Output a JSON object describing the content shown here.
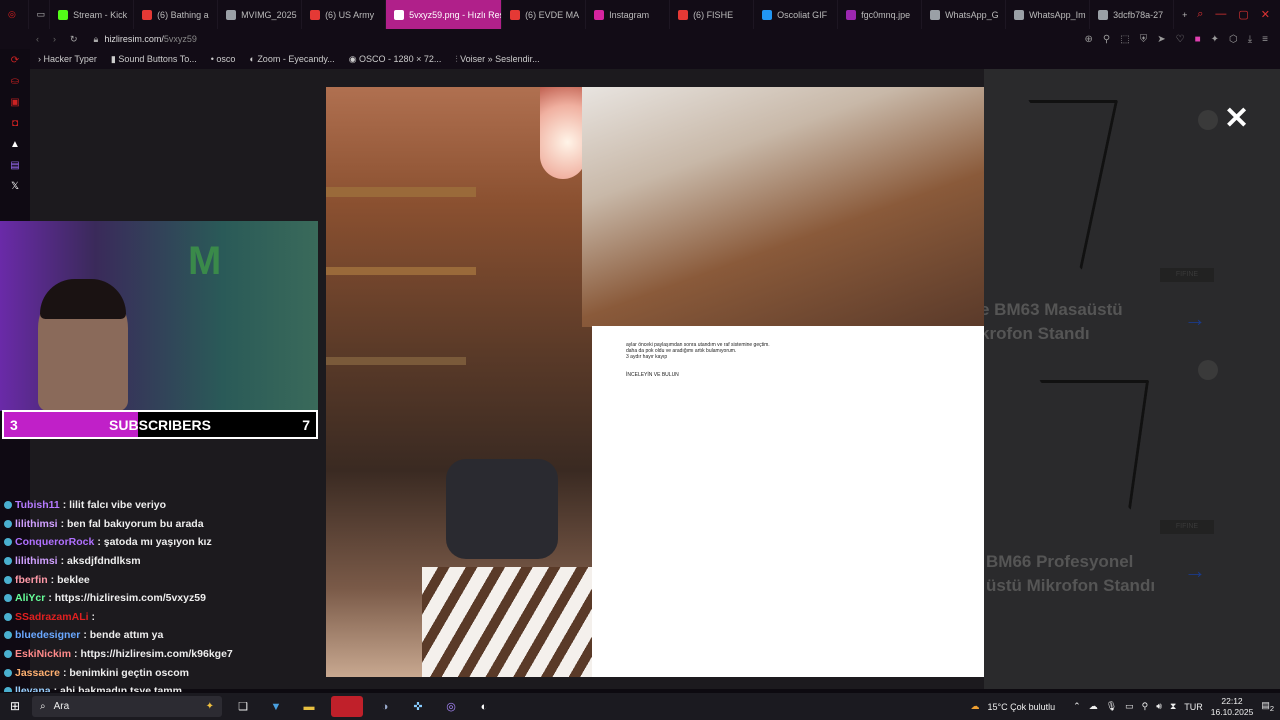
{
  "browser": {
    "tabs": [
      {
        "label": "Stream - Kick",
        "color": "#53fc18"
      },
      {
        "label": "(6) Bathing a",
        "color": "#e53935"
      },
      {
        "label": "MVIMG_2025",
        "color": "#9aa0a6"
      },
      {
        "label": "(6) US Army",
        "color": "#e53935"
      },
      {
        "label": "5vxyz59.png - Hızlı Res",
        "color": "#ffffff"
      },
      {
        "label": "(6) EVDE MA",
        "color": "#e53935"
      },
      {
        "label": "Instagram",
        "color": "#d6249f"
      },
      {
        "label": "(6) FISHE",
        "color": "#e53935"
      },
      {
        "label": "Oscoliat GIF",
        "color": "#2196f3"
      },
      {
        "label": "fgc0mnq.jpe",
        "color": "#9c27b0"
      },
      {
        "label": "WhatsApp_G",
        "color": "#9aa0a6"
      },
      {
        "label": "WhatsApp_Im",
        "color": "#9aa0a6"
      },
      {
        "label": "3dcfb78a-27",
        "color": "#9aa0a6"
      }
    ],
    "url_host": "hizliresim.com/",
    "url_path": "5vxyz59"
  },
  "bookmarks": [
    "Hacker Typer",
    "Sound Buttons To...",
    "osco",
    "Zoom - Eyecandy...",
    "OSCO - 1280 × 72...",
    "Voiser » Seslendir..."
  ],
  "background_page": {
    "product1": "e BM63 Masaüstü\nkrofon Standı",
    "product2": "BM66 Profesyonel\nüstü Mikrofon Standı",
    "badge": "FIFINE"
  },
  "note": {
    "text": "aylar önceki paylaşımdan sonra utandım ve raf sistemine geçtim.\ndaha da pok oldu ve aradığımı artık bulamıyorum.\n3 aydır hayır kayıp",
    "caption": "İNCELEYİN VE BULUN"
  },
  "subscribers": {
    "left": "3",
    "label": "SUBSCRIBERS",
    "right": "7",
    "progress_percent": 43
  },
  "chat": [
    {
      "user": "Tubish11",
      "color": "#b57aff",
      "text": ": lilit falcı vibe veriyo"
    },
    {
      "user": "lilithimsi",
      "color": "#d0a0ff",
      "text": ": ben fal bakıyorum bu arada"
    },
    {
      "user": "ConquerorRock",
      "color": "#b070ff",
      "text": ": şatoda mı yaşıyon kız"
    },
    {
      "user": "lilithimsi",
      "color": "#d0a0ff",
      "text": ": aksdjfdndlksm"
    },
    {
      "user": "fberfin",
      "color": "#ff9aa8",
      "text": ": beklee"
    },
    {
      "user": "AliYcr",
      "color": "#66ff99",
      "text": ": https://hizliresim.com/5vxyz59"
    },
    {
      "user": "SSadrazamALi",
      "color": "#e02020",
      "text": ":"
    },
    {
      "user": "bluedesigner",
      "color": "#6aa8ff",
      "text": ": bende attım ya"
    },
    {
      "user": "EskiNickim",
      "color": "#ff8a8a",
      "text": ": https://hizliresim.com/k96kge7"
    },
    {
      "user": "Jassacre",
      "color": "#ffb070",
      "text": ": benimkini geçtin oscom"
    },
    {
      "user": "llevana",
      "color": "#9ad0ff",
      "text": ": abi bakmadın tsye tamm"
    }
  ],
  "taskbar": {
    "search_placeholder": "Ara",
    "weather": "15°C  Çok bulutlu",
    "lang": "TUR",
    "time": "22:12",
    "date": "16.10.2025",
    "notifications": "2"
  }
}
